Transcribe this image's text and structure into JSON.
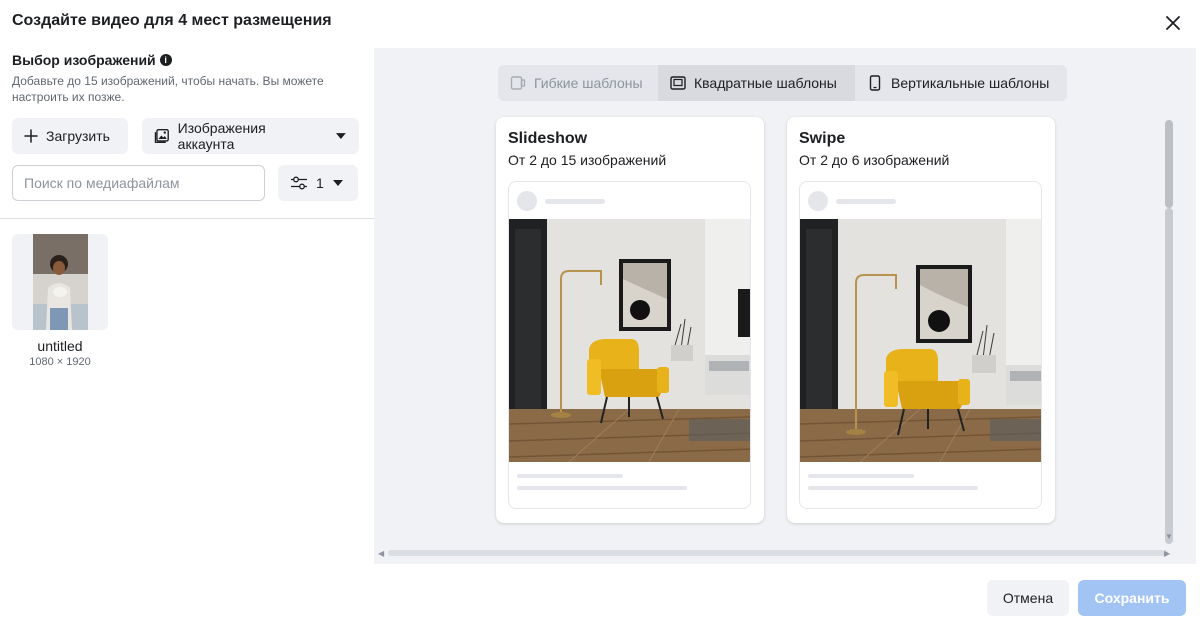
{
  "dialog": {
    "title": "Создайте видео для 4 мест размещения"
  },
  "images_panel": {
    "title": "Выбор изображений",
    "description": "Добавьте до 15 изображений, чтобы начать. Вы можете настроить их позже.",
    "upload_label": "Загрузить",
    "account_images_label": "Изображения аккаунта",
    "search_placeholder": "Поиск по медиафайлам",
    "filter_count": "1",
    "media": [
      {
        "name": "untitled",
        "dimensions": "1080 × 1920"
      }
    ]
  },
  "templates": {
    "tabs": [
      {
        "label": "Гибкие шаблоны",
        "state": "disabled"
      },
      {
        "label": "Квадратные шаблоны",
        "state": "selected"
      },
      {
        "label": "Вертикальные шаблоны",
        "state": "default"
      }
    ],
    "cards": [
      {
        "title": "Slideshow",
        "subtitle": "От 2 до 15 изображений"
      },
      {
        "title": "Swipe",
        "subtitle": "От 2 до 6 изображений"
      }
    ]
  },
  "footer": {
    "cancel_label": "Отмена",
    "save_label": "Сохранить"
  },
  "colors": {
    "panel_bg": "#f0f2f5",
    "save_disabled": "#a2c4f4",
    "chair_yellow": "#e8b21a"
  },
  "icons": {
    "close": "close-icon",
    "info": "info-icon",
    "upload": "plus-icon",
    "account_images": "image-gallery-icon",
    "dropdown": "caret-down-icon",
    "filter": "sliders-icon",
    "flexible_tab": "flexible-device-icon",
    "square_tab": "square-device-icon",
    "vertical_tab": "phone-icon"
  }
}
